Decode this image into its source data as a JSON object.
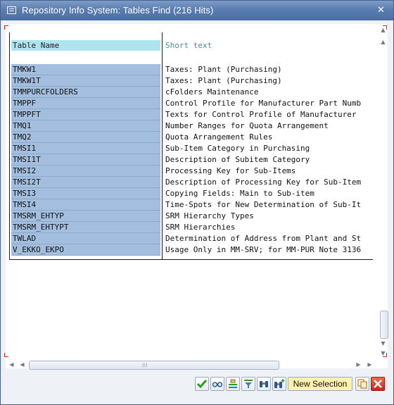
{
  "window": {
    "title": "Repository Info System: Tables Find (216 Hits)",
    "close_glyph": "✕"
  },
  "table": {
    "headers": {
      "name": "Table Name",
      "short_text": "Short text"
    },
    "rows": [
      {
        "name": "TMKW1",
        "text": "Taxes: Plant (Purchasing)"
      },
      {
        "name": "TMKW1T",
        "text": "Taxes: Plant (Purchasing)"
      },
      {
        "name": "TMMPURCFOLDERS",
        "text": "cFolders Maintenance"
      },
      {
        "name": "TMPPF",
        "text": "Control Profile for Manufacturer Part Numb"
      },
      {
        "name": "TMPPFT",
        "text": "Texts for Control Profile of Manufacturer"
      },
      {
        "name": "TMQ1",
        "text": "Number Ranges for Quota Arrangement"
      },
      {
        "name": "TMQ2",
        "text": "Quota Arrangement Rules"
      },
      {
        "name": "TMSI1",
        "text": "Sub-Item Category in Purchasing"
      },
      {
        "name": "TMSI1T",
        "text": "Description of Subitem Category"
      },
      {
        "name": "TMSI2",
        "text": "Processing Key for Sub-Items"
      },
      {
        "name": "TMSI2T",
        "text": "Description of Processing Key for Sub-Item"
      },
      {
        "name": "TMSI3",
        "text": "Copying Fields: Main to Sub-item"
      },
      {
        "name": "TMSI4",
        "text": "Time-Spots for New Determination of Sub-It"
      },
      {
        "name": "TMSRM_EHTYP",
        "text": "SRM Hierarchy Types"
      },
      {
        "name": "TMSRM_EHTYPT",
        "text": "SRM Hierarchies"
      },
      {
        "name": "TWLAD",
        "text": "Determination of Address from Plant and St"
      },
      {
        "name": "V_EKKO_EKPO",
        "text": "Usage Only in MM-SRV; for MM-PUR Note 3136"
      }
    ]
  },
  "toolbar": {
    "new_selection_label": "New Selection",
    "icons": [
      "check-icon",
      "glasses-icon",
      "select-icon",
      "filter-icon",
      "binoculars-icon",
      "binoculars-plus-icon",
      "copy-icon",
      "cancel-icon"
    ]
  },
  "colors": {
    "titlebar": "#5a7db1",
    "header_highlight": "#aee3ef",
    "name_cell": "#a3bede",
    "new_selection_bg": "#fff2b0",
    "cancel_red": "#d8201c"
  }
}
